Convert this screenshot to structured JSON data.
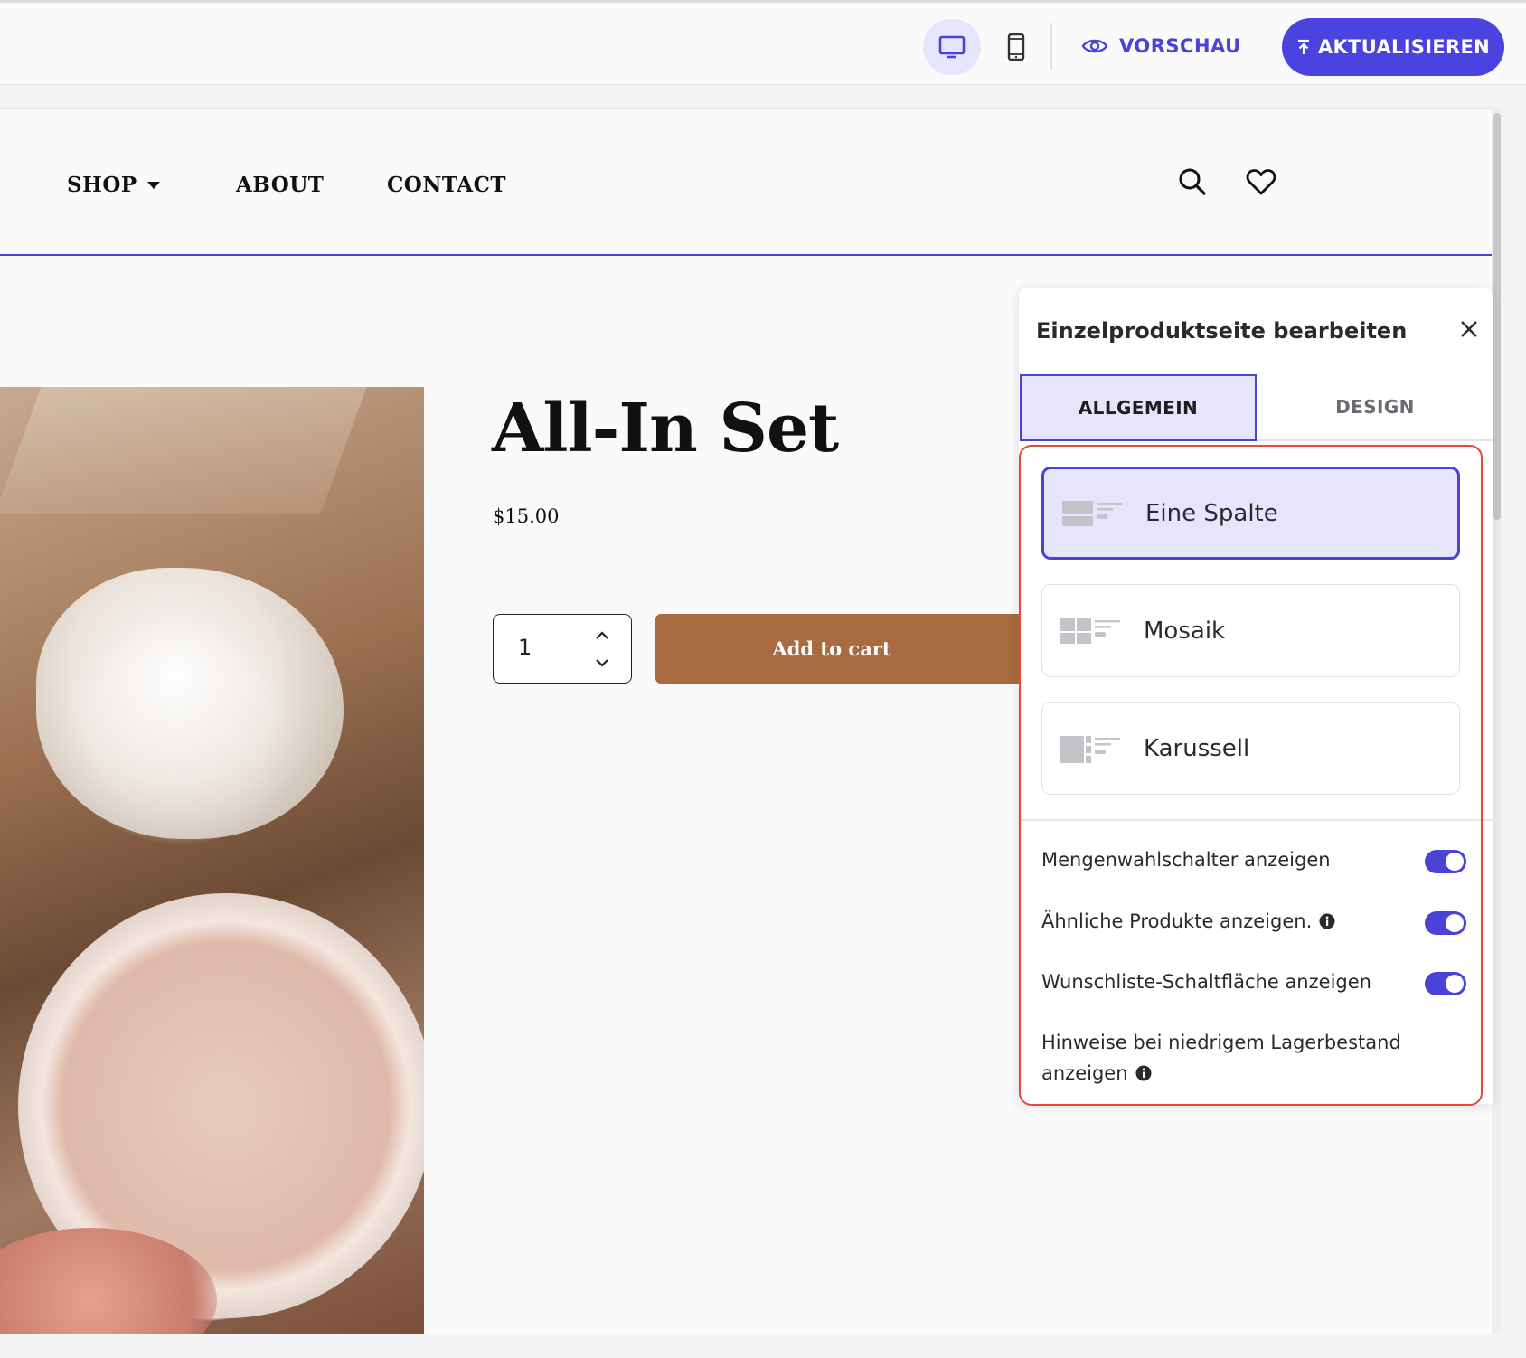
{
  "toolbar": {
    "desktop_icon": "desktop-icon",
    "mobile_icon": "mobile-icon",
    "preview_label": "VORSCHAU",
    "publish_label": "AKTUALISIEREN",
    "accent_color": "#4a43e0"
  },
  "store": {
    "nav": [
      {
        "label": "SHOP",
        "has_dropdown": true
      },
      {
        "label": "ABOUT"
      },
      {
        "label": "CONTACT"
      }
    ],
    "icons": [
      "search-icon",
      "heart-icon"
    ],
    "product": {
      "title": "All-In Set",
      "price": "$15.00",
      "quantity": "1",
      "add_to_cart_label": "Add to cart",
      "button_color": "#a86a3e"
    }
  },
  "panel": {
    "title": "Einzelproduktseite bearbeiten",
    "tabs": [
      {
        "label": "ALLGEMEIN",
        "active": true
      },
      {
        "label": "DESIGN",
        "active": false
      }
    ],
    "layouts": [
      {
        "label": "Eine Spalte",
        "selected": true
      },
      {
        "label": "Mosaik",
        "selected": false
      },
      {
        "label": "Karussell",
        "selected": false
      }
    ],
    "toggles": [
      {
        "label": "Mengenwahlschalter anzeigen",
        "on": true,
        "info": false
      },
      {
        "label": "Ähnliche Produkte anzeigen.",
        "on": true,
        "info": true
      },
      {
        "label": "Wunschliste-Schaltfläche anzeigen",
        "on": true,
        "info": false
      },
      {
        "label": "Hinweise bei niedrigem Lagerbestand anzeigen",
        "on": null,
        "info": true
      }
    ],
    "highlight_color": "#e34a3a"
  }
}
